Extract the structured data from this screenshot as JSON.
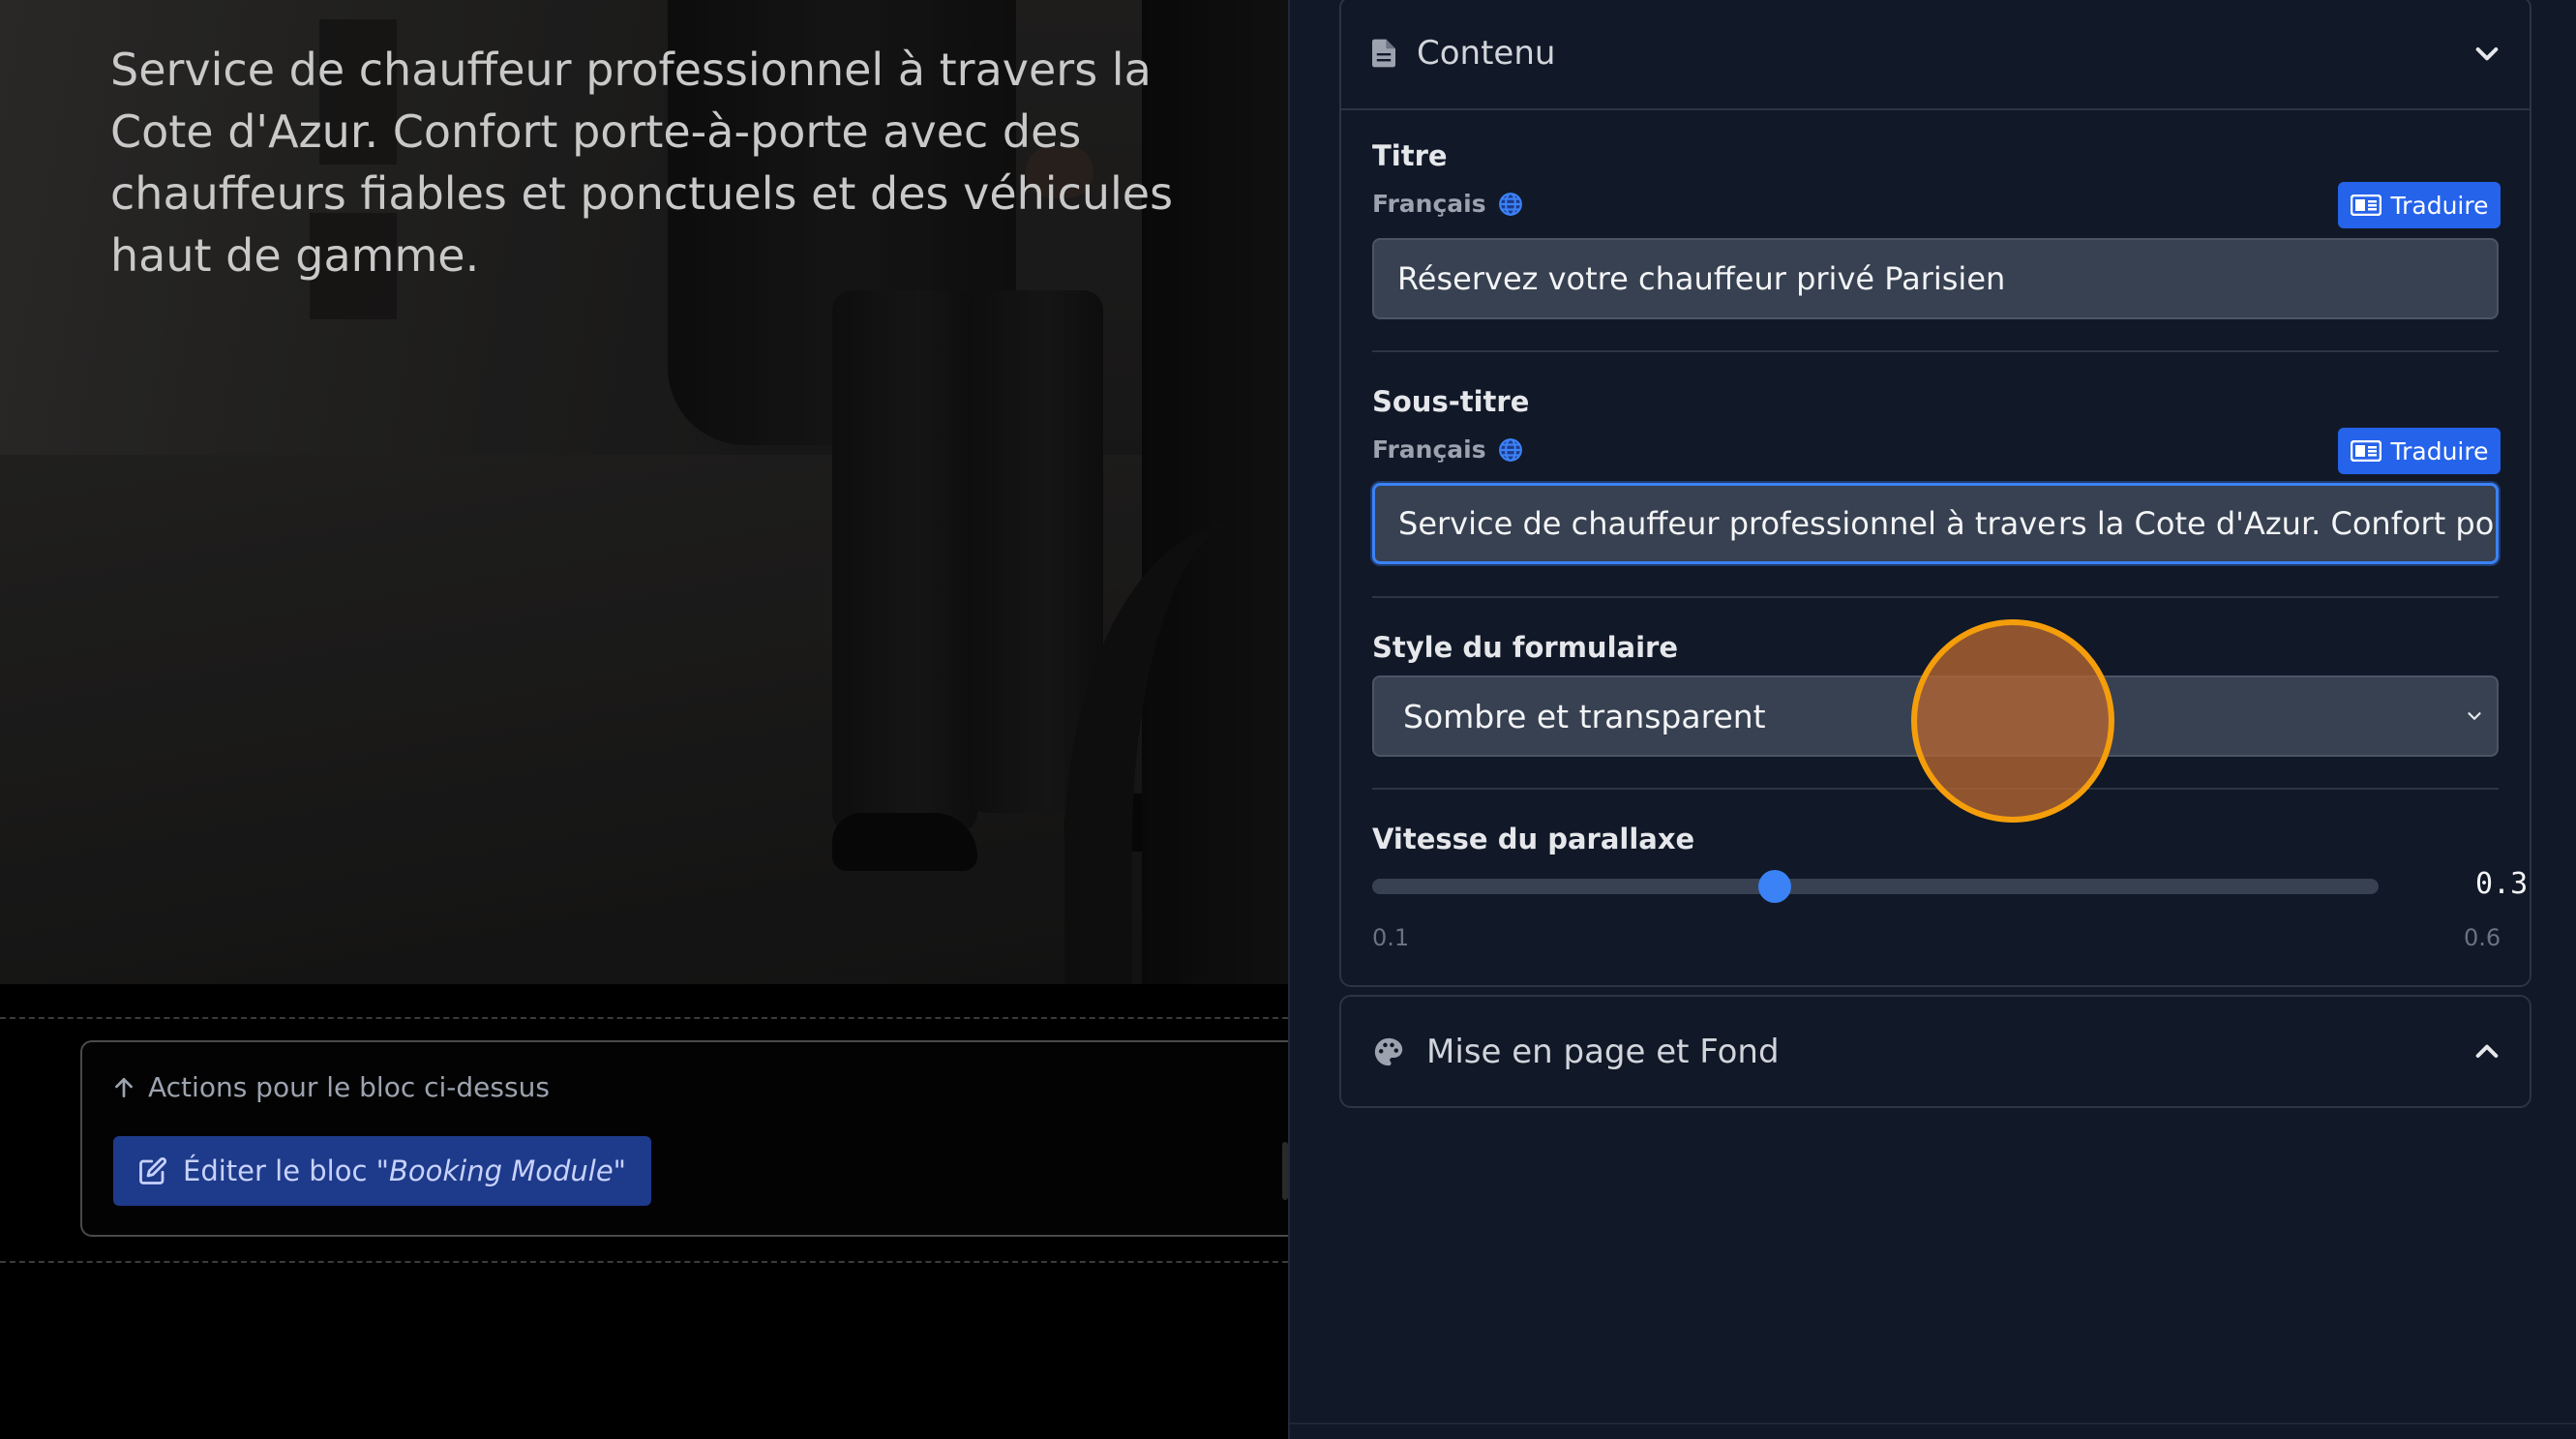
{
  "preview": {
    "hero_subtitle": "Service de chauffeur professionnel à travers la Cote d'Azur. Confort porte-à-porte avec des chauffeurs fiables et ponctuels et des véhicules haut de gamme.",
    "actions": {
      "title": "Actions pour le bloc ci-dessus",
      "edit_prefix": "Éditer le bloc \"",
      "edit_block_name": "Booking Module",
      "edit_suffix": "\""
    }
  },
  "panel": {
    "content_section": {
      "title": "Contenu",
      "icon": "document-icon",
      "expanded": true,
      "titre": {
        "label": "Titre",
        "language": "Français",
        "translate_label": "Traduire",
        "value": "Réservez votre chauffeur privé Parisien"
      },
      "sous_titre": {
        "label": "Sous-titre",
        "language": "Français",
        "translate_label": "Traduire",
        "value_before_caret": "Service de chauffeur professionnel à trave",
        "value_after_caret": "rs la Cote d'Azur. Confort po"
      },
      "style": {
        "label": "Style du formulaire",
        "selected": "Sombre et transparent"
      },
      "parallax": {
        "label": "Vitesse du parallaxe",
        "value": "0.3",
        "value_number": 0.3,
        "min": "0.1",
        "min_number": 0.1,
        "max": "0.6",
        "max_number": 0.6
      }
    },
    "layout_section": {
      "title": "Mise en page et Fond",
      "icon": "palette-icon",
      "expanded": false
    }
  },
  "colors": {
    "accent": "#2563eb",
    "panel_bg": "#111827",
    "input_bg": "#374151",
    "focus_ring": "#3b82f6",
    "click_marker": "#f59e0b"
  }
}
